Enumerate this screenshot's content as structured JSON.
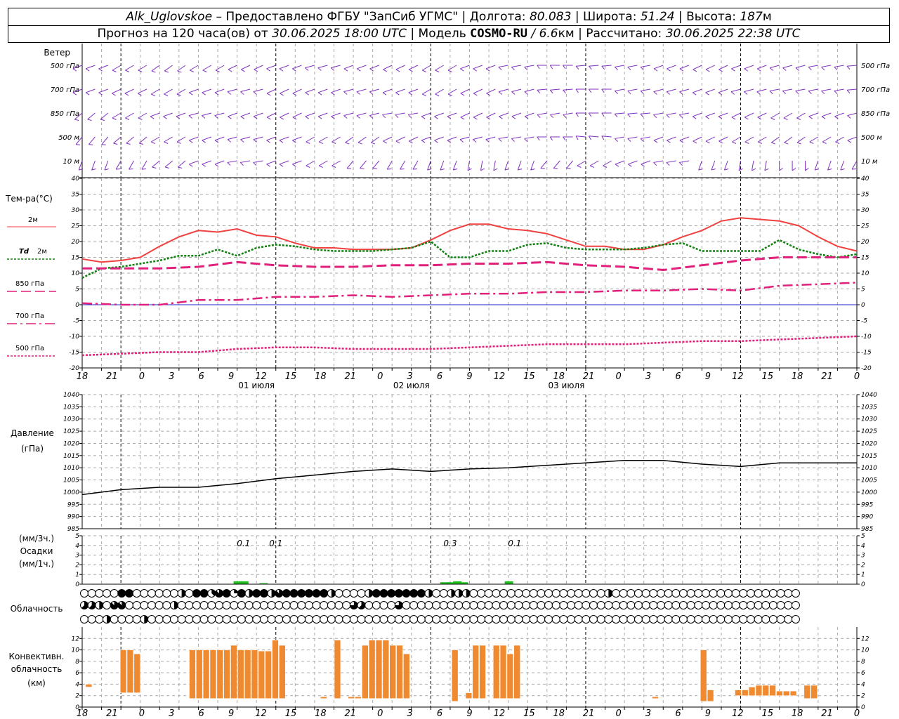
{
  "header": {
    "station": "Alk_Uglovskoe",
    "dash": " – ",
    "provider": "Предоставлено ФГБУ \"ЗапСиб УГМС\"",
    "sep": " | ",
    "lon_label": "Долгота:",
    "lon_value": "80.083",
    "lat_label": "Широта:",
    "lat_value": "51.24",
    "alt_label": "Высота:",
    "alt_value": "187",
    "alt_unit": "м",
    "forecast_prefix": "Прогноз на 120 часа(ов)  от",
    "forecast_time": "30.06.2025 18:00 UTC",
    "model_label": "Модель",
    "model_name": "COSMO-RU",
    "model_res_sep": " / ",
    "model_res": "6.6",
    "model_res_unit": "км",
    "calc_label": "Рассчитано:",
    "calc_time": "30.06.2025 22:38 UTC"
  },
  "labels": {
    "wind": "Ветер",
    "wind_levels": [
      "500 гПа",
      "700 гПа",
      "850 гПа",
      "500  м",
      "10   м"
    ],
    "temp": "Тем-ра(°C)",
    "t2m": "2м",
    "td_a": "Td",
    "td_b": "2м",
    "t850": "850 гПа",
    "t700": "700 гПа",
    "t500": "500 гПа",
    "pressure_a": "Давление",
    "pressure_b": "(гПа)",
    "precip_a": "(мм/3ч.)",
    "precip_b": "Осадки",
    "precip_c": "(мм/1ч.)",
    "cloud": "Облачность",
    "conv_a": "Конвективн.",
    "conv_b": "облачность",
    "conv_c": "(км)"
  },
  "time_axis": {
    "tick_labels": [
      "18",
      "21",
      "0",
      "3",
      "6",
      "9",
      "12",
      "15",
      "18",
      "21",
      "0",
      "3",
      "6",
      "9",
      "12",
      "15",
      "18",
      "21",
      "0",
      "3",
      "6",
      "9",
      "12",
      "15",
      "18",
      "21",
      "0"
    ],
    "days": [
      "01 июля",
      "02 июля",
      "03 июля"
    ]
  },
  "colors": {
    "t2m": "#f04040",
    "td2m": "#108010",
    "t850": "#e0207a",
    "t700": "#e0207a",
    "t500": "#e0207a",
    "zero": "#2020c0",
    "wind": "#8030c0",
    "precip": "#20c020",
    "conv": "#f08a30"
  },
  "chart_data": [
    {
      "type": "line",
      "name": "temperature",
      "x_unit": "hours from 30.06.2025 18:00 UTC",
      "ylim": [
        -20,
        40
      ],
      "yticks": [
        -20,
        -15,
        -10,
        -5,
        0,
        5,
        10,
        15,
        20,
        25,
        30,
        35,
        40
      ],
      "series": [
        {
          "name": "2м",
          "x": [
            0,
            3,
            6,
            9,
            12,
            15,
            18,
            21,
            24,
            27,
            30,
            33,
            36,
            39,
            42,
            45,
            48,
            51,
            54,
            57,
            60,
            63,
            66,
            69,
            72,
            75,
            78,
            81,
            84,
            87,
            90,
            93,
            96,
            99,
            102,
            105,
            108,
            111,
            114,
            117,
            120
          ],
          "y": [
            14.5,
            13.5,
            14,
            15,
            18.5,
            21.5,
            23.5,
            23,
            24,
            22,
            21.5,
            19.5,
            18,
            18,
            17.5,
            17.5,
            17.5,
            18,
            20.5,
            23.5,
            25.5,
            25.5,
            24,
            23.5,
            22.5,
            20.5,
            18.5,
            18.5,
            17.5,
            17.5,
            19,
            21.5,
            23.5,
            26.5,
            27.5,
            27,
            26.5,
            25,
            21.5,
            18.5,
            17
          ]
        },
        {
          "name": "Td 2м",
          "x": [
            0,
            3,
            6,
            9,
            12,
            15,
            18,
            21,
            24,
            27,
            30,
            33,
            36,
            39,
            42,
            45,
            48,
            51,
            54,
            57,
            60,
            63,
            66,
            69,
            72,
            75,
            78,
            81,
            84,
            87,
            90,
            93,
            96,
            99,
            102,
            105,
            108,
            111,
            114,
            117,
            120
          ],
          "y": [
            8.5,
            11.5,
            12,
            13,
            14,
            15.5,
            15.5,
            17.5,
            15.5,
            18,
            19,
            18.5,
            17.5,
            17,
            17,
            17,
            17.5,
            18,
            20,
            15,
            15,
            17,
            17,
            19,
            19.5,
            18,
            17.5,
            17.5,
            17.5,
            18,
            19,
            19.5,
            17,
            17,
            17,
            17,
            20.5,
            17.5,
            16,
            15,
            16
          ]
        },
        {
          "name": "850 гПа",
          "x": [
            0,
            6,
            12,
            18,
            24,
            30,
            36,
            42,
            48,
            54,
            60,
            66,
            72,
            78,
            84,
            90,
            96,
            102,
            108,
            114,
            120
          ],
          "y": [
            11.5,
            11.5,
            11.5,
            12,
            13.5,
            12.5,
            12,
            12,
            12.5,
            12.5,
            13,
            13,
            13.5,
            12.5,
            12,
            11,
            12.5,
            14,
            15,
            15,
            15
          ]
        },
        {
          "name": "700 гПа",
          "x": [
            0,
            6,
            12,
            18,
            24,
            30,
            36,
            42,
            48,
            54,
            60,
            66,
            72,
            78,
            84,
            90,
            96,
            102,
            108,
            114,
            120
          ],
          "y": [
            0.5,
            0,
            0,
            1.5,
            1.5,
            2.5,
            2.5,
            3,
            2.5,
            3,
            3.5,
            3.5,
            4,
            4,
            4.5,
            4.5,
            5,
            4.5,
            6,
            6.5,
            7
          ]
        },
        {
          "name": "500 гПа",
          "x": [
            0,
            6,
            12,
            18,
            24,
            30,
            36,
            42,
            48,
            54,
            60,
            66,
            72,
            78,
            84,
            90,
            96,
            102,
            108,
            114,
            120
          ],
          "y": [
            -16,
            -15.5,
            -15,
            -15,
            -14,
            -13.5,
            -13.5,
            -14,
            -14,
            -14,
            -13.5,
            -13,
            -12.5,
            -12.5,
            -12.5,
            -12,
            -11.5,
            -11.5,
            -11,
            -10.5,
            -10
          ]
        }
      ]
    },
    {
      "type": "line",
      "name": "pressure",
      "ylim": [
        985,
        1040
      ],
      "yticks": [
        985,
        990,
        995,
        1000,
        1005,
        1010,
        1015,
        1020,
        1025,
        1030,
        1035,
        1040
      ],
      "series": [
        {
          "name": "pressure",
          "x": [
            0,
            6,
            12,
            18,
            24,
            30,
            36,
            42,
            48,
            54,
            60,
            66,
            72,
            78,
            84,
            90,
            96,
            102,
            108,
            114,
            120
          ],
          "y": [
            999,
            1001,
            1002,
            1002,
            1003.5,
            1005.5,
            1007,
            1008.5,
            1009.5,
            1008.5,
            1009.5,
            1010,
            1011,
            1012,
            1013,
            1013,
            1011.5,
            1010.5,
            1012,
            1012,
            1012
          ]
        }
      ]
    },
    {
      "type": "bar",
      "name": "precipitation",
      "ylim": [
        0,
        5
      ],
      "yticks": [
        0,
        1,
        2,
        3,
        4,
        5
      ],
      "bars": [
        {
          "x": 24,
          "y": 0.3
        },
        {
          "x": 25,
          "y": 0.3
        },
        {
          "x": 28,
          "y": 0.1
        },
        {
          "x": 56,
          "y": 0.2
        },
        {
          "x": 57,
          "y": 0.2
        },
        {
          "x": 58,
          "y": 0.3
        },
        {
          "x": 59,
          "y": 0.2
        },
        {
          "x": 66,
          "y": 0.3
        }
      ],
      "annotations": [
        {
          "x": 25,
          "text": "0.1"
        },
        {
          "x": 30,
          "text": "0.1"
        },
        {
          "x": 57,
          "text": "0.3"
        },
        {
          "x": 67,
          "text": "0.1"
        }
      ]
    },
    {
      "type": "table",
      "name": "cloudiness",
      "cover_levels": "okta 0-8",
      "rows": [
        [
          0,
          0,
          0,
          0,
          0,
          8,
          8,
          0,
          0,
          0,
          0,
          0,
          0,
          4,
          0,
          8,
          8,
          3,
          7,
          8,
          2,
          8,
          4,
          8,
          8,
          4,
          7,
          8,
          8,
          8,
          8,
          8,
          8,
          4,
          0,
          0,
          0,
          0,
          4,
          8,
          8,
          8,
          8,
          8,
          8,
          8,
          4,
          0,
          0,
          4,
          4,
          4,
          0,
          0,
          0,
          0,
          0,
          0,
          0,
          0,
          0,
          0,
          0,
          0,
          0,
          0,
          0,
          0,
          0,
          0,
          4,
          0,
          0,
          0,
          0,
          0,
          0,
          0,
          0,
          0,
          0,
          0,
          0,
          0,
          0,
          0,
          0,
          0,
          0,
          0,
          0,
          0,
          0,
          0,
          0,
          0,
          0,
          0,
          0,
          0,
          0,
          0,
          0,
          0,
          0,
          0,
          0,
          0,
          0,
          0,
          0,
          0,
          0,
          0,
          0,
          0,
          0,
          0,
          0,
          0,
          0
        ],
        [
          5,
          5,
          4,
          0,
          7,
          7,
          0,
          0,
          0,
          0,
          0,
          0,
          4,
          0,
          0,
          0,
          0,
          0,
          0,
          0,
          0,
          0,
          0,
          0,
          0,
          0,
          0,
          0,
          0,
          0,
          0,
          0,
          0,
          0,
          0,
          0,
          6,
          5,
          0,
          0,
          0,
          0,
          6,
          0,
          0,
          0,
          0,
          0,
          0,
          0,
          0,
          0,
          0,
          0,
          0,
          0,
          0,
          0,
          0,
          0,
          0,
          0,
          0,
          0,
          0,
          0,
          0,
          0,
          0,
          0,
          0,
          0,
          0,
          0,
          0,
          0,
          0,
          0,
          0,
          0,
          0,
          0,
          0,
          0,
          0,
          0,
          0,
          0,
          0,
          0,
          0,
          0,
          0,
          0,
          0,
          0,
          0,
          0,
          0,
          0,
          0,
          0,
          0,
          0,
          0,
          0,
          0,
          0,
          0,
          0,
          0,
          0,
          0,
          0,
          0,
          0,
          0,
          0,
          0,
          0,
          0
        ],
        [
          0,
          0,
          0,
          4,
          0,
          0,
          0,
          0,
          4,
          0,
          0,
          0,
          0,
          0,
          0,
          0,
          0,
          0,
          0,
          0,
          0,
          0,
          0,
          0,
          0,
          0,
          0,
          0,
          0,
          0,
          0,
          0,
          0,
          0,
          0,
          0,
          0,
          0,
          0,
          0,
          0,
          0,
          0,
          0,
          0,
          0,
          0,
          0,
          0,
          0,
          0,
          0,
          0,
          0,
          0,
          0,
          0,
          0,
          0,
          0,
          0,
          0,
          0,
          0,
          0,
          0,
          0,
          0,
          0,
          0,
          0,
          0,
          0,
          0,
          0,
          0,
          0,
          0,
          0,
          0,
          0,
          0,
          0,
          0,
          0,
          0,
          0,
          0,
          0,
          0,
          0,
          0,
          0,
          0,
          0,
          0,
          0,
          0,
          0,
          0,
          0,
          0,
          0,
          0,
          0,
          0,
          0,
          0,
          0,
          0,
          0,
          0,
          0,
          0,
          0,
          0,
          0,
          0,
          0,
          0,
          0
        ]
      ]
    },
    {
      "type": "bar",
      "name": "convective_cloud",
      "ylim": [
        0,
        14
      ],
      "yticks": [
        0,
        2,
        4,
        6,
        8,
        10,
        12
      ],
      "bars": [
        {
          "x": 0,
          "y0": 3.5,
          "y1": 4
        },
        {
          "x": 5,
          "y0": 2.5,
          "y1": 10
        },
        {
          "x": 6,
          "y0": 2.5,
          "y1": 10
        },
        {
          "x": 7,
          "y0": 2.5,
          "y1": 9.3
        },
        {
          "x": 15,
          "y0": 1.5,
          "y1": 10
        },
        {
          "x": 16,
          "y0": 1.5,
          "y1": 10
        },
        {
          "x": 17,
          "y0": 1.5,
          "y1": 10
        },
        {
          "x": 18,
          "y0": 1.5,
          "y1": 10
        },
        {
          "x": 19,
          "y0": 1.5,
          "y1": 10
        },
        {
          "x": 20,
          "y0": 1.5,
          "y1": 10
        },
        {
          "x": 21,
          "y0": 1.5,
          "y1": 10.8
        },
        {
          "x": 22,
          "y0": 1.5,
          "y1": 10
        },
        {
          "x": 23,
          "y0": 1.5,
          "y1": 10
        },
        {
          "x": 24,
          "y0": 1.5,
          "y1": 10
        },
        {
          "x": 25,
          "y0": 1.5,
          "y1": 9.8
        },
        {
          "x": 26,
          "y0": 1.5,
          "y1": 9.8
        },
        {
          "x": 27,
          "y0": 1.5,
          "y1": 11.7
        },
        {
          "x": 28,
          "y0": 1.5,
          "y1": 10.8
        },
        {
          "x": 34,
          "y0": 1.5,
          "y1": 1.8
        },
        {
          "x": 36,
          "y0": 1.5,
          "y1": 11.7
        },
        {
          "x": 38,
          "y0": 1.5,
          "y1": 1.8
        },
        {
          "x": 39,
          "y0": 1.5,
          "y1": 1.8
        },
        {
          "x": 40,
          "y0": 1.5,
          "y1": 10.8
        },
        {
          "x": 41,
          "y0": 1.5,
          "y1": 11.7
        },
        {
          "x": 42,
          "y0": 1.5,
          "y1": 11.7
        },
        {
          "x": 43,
          "y0": 1.5,
          "y1": 11.7
        },
        {
          "x": 44,
          "y0": 1.5,
          "y1": 10.8
        },
        {
          "x": 45,
          "y0": 1.5,
          "y1": 10.8
        },
        {
          "x": 46,
          "y0": 1.5,
          "y1": 9.3
        },
        {
          "x": 53,
          "y0": 1,
          "y1": 10
        },
        {
          "x": 55,
          "y0": 1.5,
          "y1": 2.5
        },
        {
          "x": 56,
          "y0": 1.5,
          "y1": 10.8
        },
        {
          "x": 57,
          "y0": 1.5,
          "y1": 10.8
        },
        {
          "x": 59,
          "y0": 1.5,
          "y1": 10.8
        },
        {
          "x": 60,
          "y0": 1.5,
          "y1": 10.8
        },
        {
          "x": 61,
          "y0": 1.5,
          "y1": 9.3
        },
        {
          "x": 62,
          "y0": 1.5,
          "y1": 10.8
        },
        {
          "x": 82,
          "y0": 1.5,
          "y1": 1.8
        },
        {
          "x": 89,
          "y0": 1,
          "y1": 10
        },
        {
          "x": 90,
          "y0": 1,
          "y1": 3
        },
        {
          "x": 94,
          "y0": 2,
          "y1": 3
        },
        {
          "x": 95,
          "y0": 2,
          "y1": 3
        },
        {
          "x": 96,
          "y0": 2,
          "y1": 3.5
        },
        {
          "x": 97,
          "y0": 2,
          "y1": 3.8
        },
        {
          "x": 98,
          "y0": 2,
          "y1": 3.8
        },
        {
          "x": 99,
          "y0": 2,
          "y1": 3.8
        },
        {
          "x": 100,
          "y0": 2,
          "y1": 2.8
        },
        {
          "x": 101,
          "y0": 2,
          "y1": 2.8
        },
        {
          "x": 102,
          "y0": 2,
          "y1": 2.8
        },
        {
          "x": 104,
          "y0": 1.5,
          "y1": 3.8
        },
        {
          "x": 105,
          "y0": 1.5,
          "y1": 3.8
        }
      ]
    }
  ]
}
